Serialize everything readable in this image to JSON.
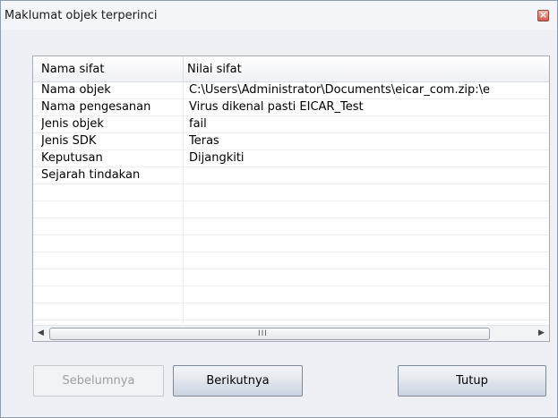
{
  "window": {
    "title": "Maklumat objek terperinci",
    "close_glyph": "×"
  },
  "grid": {
    "columns": [
      "Nama sifat",
      "Nilai sifat"
    ],
    "rows": [
      {
        "name": "Nama objek",
        "value": "C:\\Users\\Administrator\\Documents\\eicar_com.zip:\\e"
      },
      {
        "name": "Nama pengesanan",
        "value": "Virus dikenal pasti EICAR_Test"
      },
      {
        "name": "Jenis objek",
        "value": "fail"
      },
      {
        "name": "Jenis SDK",
        "value": "Teras"
      },
      {
        "name": "Keputusan",
        "value": "Dijangkiti"
      },
      {
        "name": "Sejarah tindakan",
        "value": ""
      },
      {
        "name": "",
        "value": ""
      },
      {
        "name": "",
        "value": ""
      },
      {
        "name": "",
        "value": ""
      },
      {
        "name": "",
        "value": ""
      },
      {
        "name": "",
        "value": ""
      },
      {
        "name": "",
        "value": ""
      },
      {
        "name": "",
        "value": ""
      },
      {
        "name": "",
        "value": ""
      }
    ],
    "scrollbar": {
      "left_arrow": "◀",
      "right_arrow": "▶",
      "grip": "III"
    }
  },
  "buttons": {
    "previous": "Sebelumnya",
    "next": "Berikutnya",
    "close": "Tutup"
  },
  "colors": {
    "window_bg": "#eef0f6",
    "button_gradient_bottom": "#c9d3e1",
    "close_red": "#d8584a"
  },
  "icons": {
    "close": "close-icon",
    "scroll_left": "scroll-left-icon",
    "scroll_right": "scroll-right-icon"
  }
}
